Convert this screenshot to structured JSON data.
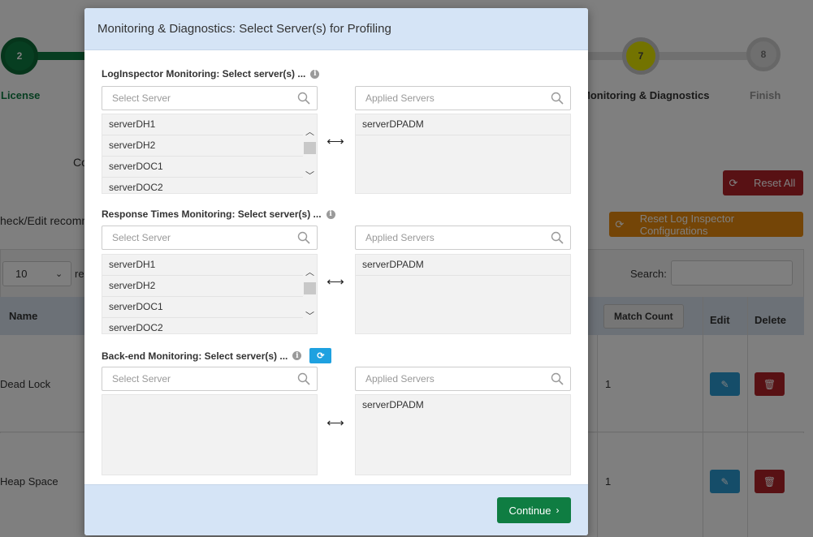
{
  "background": {
    "steps": [
      {
        "number": "2",
        "label": "License"
      },
      {
        "number": "7",
        "label": "Monitoring & Diagnostics"
      },
      {
        "number": "8",
        "label": "Finish"
      }
    ],
    "config_label": "Co",
    "check_edit_text": "heck/Edit recomm",
    "reset_all_label": "Reset All",
    "reset_log_inspector_label": "Reset Log Inspector Configurations",
    "page_size_value": "10",
    "records_suffix": "re",
    "search_label": "Search:",
    "table": {
      "headers": {
        "name": "Name",
        "match_count": "Match Count",
        "edit": "Edit",
        "delete": "Delete"
      },
      "rows": [
        {
          "name": "Dead Lock",
          "match_count": "1"
        },
        {
          "name": "Heap Space",
          "match_count": "1"
        }
      ]
    },
    "colors": {
      "green": "#0f7d42",
      "reset_red": "#b12329",
      "orange": "#e88a0e",
      "edit_blue": "#2a9bd3"
    }
  },
  "modal": {
    "title": "Monitoring & Diagnostics: Select Server(s) for Profiling",
    "sections": [
      {
        "title": "LogInspector Monitoring: Select server(s) ...",
        "select_placeholder": "Select Server",
        "applied_placeholder": "Applied Servers",
        "available": [
          "serverDH1",
          "serverDH2",
          "serverDOC1",
          "serverDOC2"
        ],
        "applied": [
          "serverDPADM"
        ]
      },
      {
        "title": "Response Times Monitoring: Select server(s) ...",
        "select_placeholder": "Select Server",
        "applied_placeholder": "Applied Servers",
        "available": [
          "serverDH1",
          "serverDH2",
          "serverDOC1",
          "serverDOC2"
        ],
        "applied": [
          "serverDPADM"
        ]
      },
      {
        "title": "Back-end Monitoring: Select server(s) ...",
        "select_placeholder": "Select Server",
        "applied_placeholder": "Applied Servers",
        "available": [],
        "applied": [
          "serverDPADM"
        ]
      }
    ],
    "continue_label": "Continue",
    "icons": {
      "info": "info-icon",
      "search": "search-icon",
      "swap": "swap-arrows-icon",
      "refresh": "refresh-icon",
      "chevron": "chevron-right-icon"
    }
  }
}
